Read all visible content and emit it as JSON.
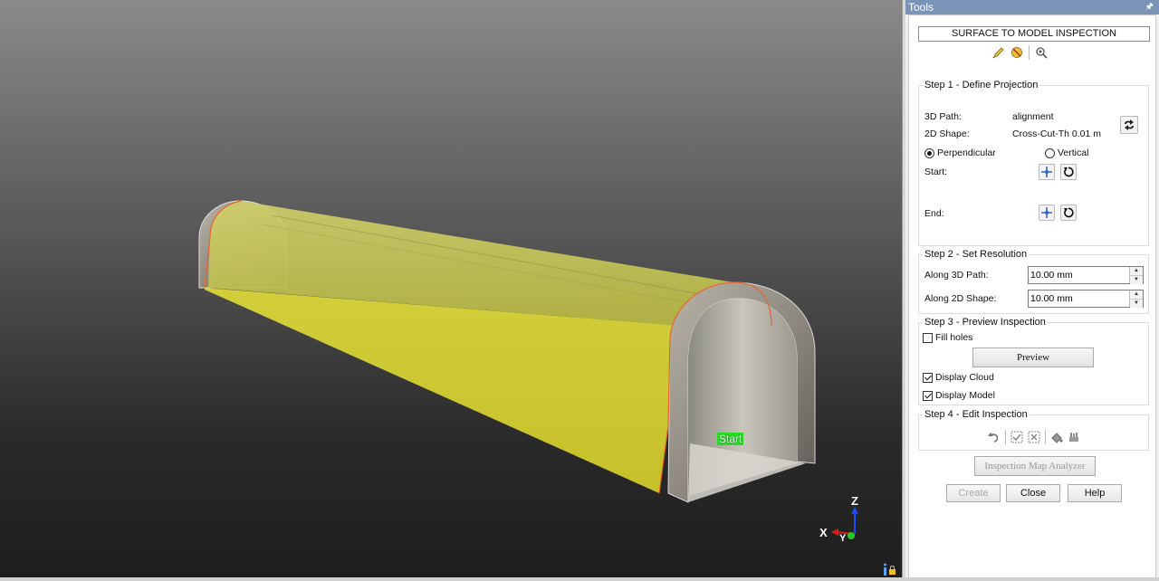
{
  "viewport": {
    "start_label": "Start",
    "axis_z": "Z",
    "axis_x": "X",
    "axis_y": "Y",
    "colors": {
      "model": "#e8e030",
      "axis_z": "#1a4cff",
      "axis_x": "#e21a1a",
      "axis_y": "#22cc22"
    }
  },
  "panel": {
    "title": "Tools",
    "pin_icon": "pin-icon",
    "banner": "SURFACE TO MODEL INSPECTION",
    "toolbar_icons": [
      "pencil-icon",
      "eraser-icon",
      "settings-icon"
    ],
    "step1": {
      "title": "Step 1 - Define Projection",
      "path_label": "3D Path:",
      "path_value": "alignment",
      "shape_label": "2D Shape:",
      "shape_value": "Cross-Cut-Th 0.01 m",
      "swap_icon": "swap-icon",
      "radio_perpendicular": "Perpendicular",
      "radio_vertical": "Vertical",
      "selected_projection": "Perpendicular",
      "start_label": "Start:",
      "end_label": "End:"
    },
    "step2": {
      "title": "Step 2 - Set Resolution",
      "along_path_label": "Along 3D Path:",
      "along_path_value": "10.00 mm",
      "along_shape_label": "Along 2D Shape:",
      "along_shape_value": "10.00 mm"
    },
    "step3": {
      "title": "Step 3 - Preview Inspection",
      "fill_holes_label": "Fill holes",
      "fill_holes_checked": false,
      "preview_label": "Preview",
      "display_cloud_label": "Display Cloud",
      "display_cloud_checked": true,
      "display_model_label": "Display Model",
      "display_model_checked": true
    },
    "step4": {
      "title": "Step 4 - Edit Inspection",
      "icons": [
        "undo-icon",
        "select-icon",
        "deselect-icon",
        "fill-icon",
        "edit-points-icon"
      ]
    },
    "analyzer_label": "Inspection Map Analyzer",
    "create_label": "Create",
    "close_label": "Close",
    "help_label": "Help"
  }
}
